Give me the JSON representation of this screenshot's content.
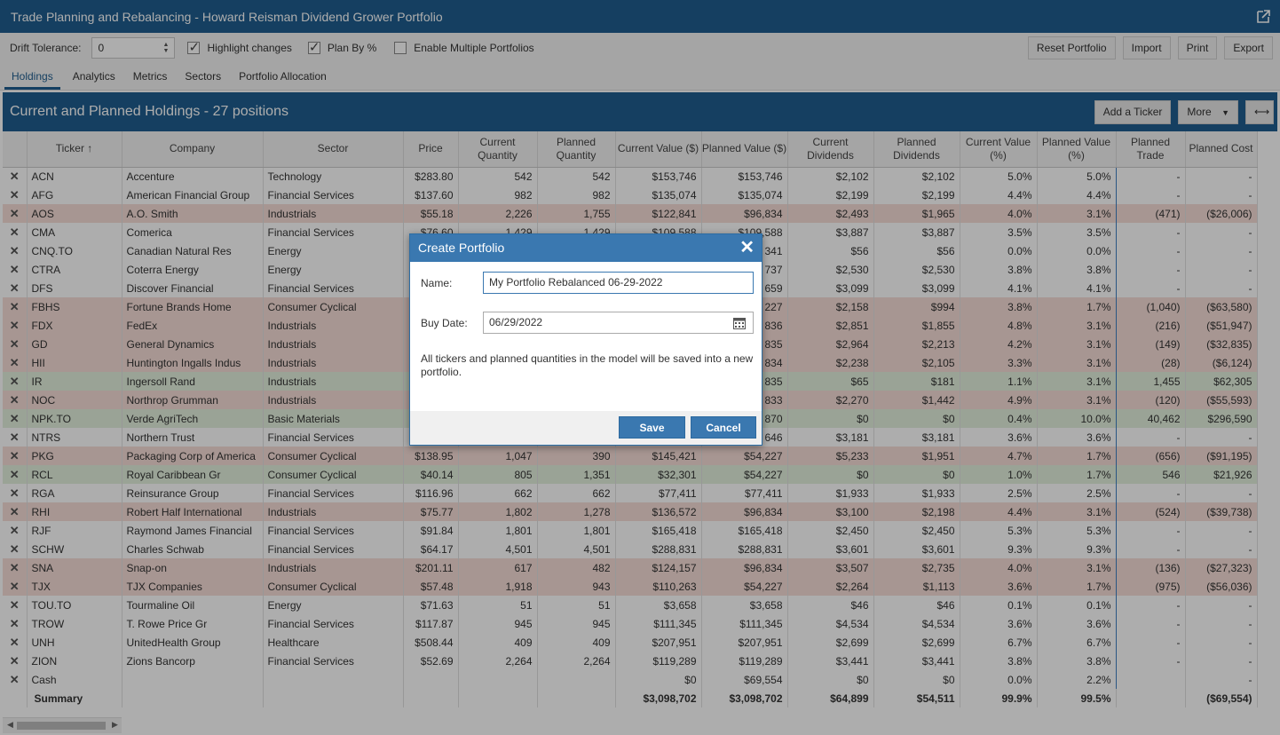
{
  "window": {
    "title": "Trade Planning and Rebalancing - Howard Reisman Dividend Grower Portfolio",
    "external_icon": "external-link-icon"
  },
  "toolbar": {
    "drift_label": "Drift Tolerance:",
    "drift_value": "0",
    "highlight_label": "Highlight changes",
    "highlight_checked": true,
    "planbypct_label": "Plan By %",
    "planbypct_checked": true,
    "multiple_label": "Enable Multiple Portfolios",
    "multiple_checked": false,
    "buttons": [
      "Reset Portfolio",
      "Import",
      "Print",
      "Export"
    ]
  },
  "tabs": [
    "Holdings",
    "Analytics",
    "Metrics",
    "Sectors",
    "Portfolio Allocation"
  ],
  "holdings": {
    "title": "Current and Planned Holdings - 27 positions",
    "add_ticker": "Add a Ticker",
    "more": "More",
    "expand_icon": "expand-horizontal-icon"
  },
  "columns": [
    "",
    "Ticker ↑",
    "Company",
    "Sector",
    "Price",
    "Current Quantity",
    "Planned Quantity",
    "Current Value ($)",
    "Planned Value ($)",
    "Current Dividends",
    "Planned Dividends",
    "Current Value (%)",
    "Planned Value (%)",
    "Planned Trade",
    "Planned Cost"
  ],
  "rows": [
    {
      "c": "white",
      "v": [
        "ACN",
        "Accenture",
        "Technology",
        "$283.80",
        "542",
        "542",
        "$153,746",
        "$153,746",
        "$2,102",
        "$2,102",
        "5.0%",
        "5.0%",
        "-",
        "-"
      ]
    },
    {
      "c": "white",
      "v": [
        "AFG",
        "American Financial Group",
        "Financial Services",
        "$137.60",
        "982",
        "982",
        "$135,074",
        "$135,074",
        "$2,199",
        "$2,199",
        "4.4%",
        "4.4%",
        "-",
        "-"
      ]
    },
    {
      "c": "red",
      "v": [
        "AOS",
        "A.O. Smith",
        "Industrials",
        "$55.18",
        "2,226",
        "1,755",
        "$122,841",
        "$96,834",
        "$2,493",
        "$1,965",
        "4.0%",
        "3.1%",
        "(471)",
        "($26,006)"
      ]
    },
    {
      "c": "white",
      "v": [
        "CMA",
        "Comerica",
        "Financial Services",
        "$76.60",
        "1,429",
        "1,429",
        "$109,588",
        "$109,588",
        "$3,887",
        "$3,887",
        "3.5%",
        "3.5%",
        "-",
        "-"
      ]
    },
    {
      "c": "white",
      "v": [
        "CNQ.TO",
        "Canadian Natural Res",
        "Energy",
        "",
        "",
        "",
        "",
        "341",
        "$56",
        "$56",
        "0.0%",
        "0.0%",
        "-",
        "-"
      ]
    },
    {
      "c": "white",
      "v": [
        "CTRA",
        "Coterra Energy",
        "Energy",
        "",
        "",
        "",
        "",
        "737",
        "$2,530",
        "$2,530",
        "3.8%",
        "3.8%",
        "-",
        "-"
      ]
    },
    {
      "c": "white",
      "v": [
        "DFS",
        "Discover Financial",
        "Financial Services",
        "",
        "",
        "",
        "",
        "659",
        "$3,099",
        "$3,099",
        "4.1%",
        "4.1%",
        "-",
        "-"
      ]
    },
    {
      "c": "red",
      "v": [
        "FBHS",
        "Fortune Brands Home",
        "Consumer Cyclical",
        "",
        "",
        "",
        "",
        "227",
        "$2,158",
        "$994",
        "3.8%",
        "1.7%",
        "(1,040)",
        "($63,580)"
      ]
    },
    {
      "c": "red",
      "v": [
        "FDX",
        "FedEx",
        "Industrials",
        "",
        "",
        "",
        "",
        "836",
        "$2,851",
        "$1,855",
        "4.8%",
        "3.1%",
        "(216)",
        "($51,947)"
      ]
    },
    {
      "c": "red",
      "v": [
        "GD",
        "General Dynamics",
        "Industrials",
        "",
        "",
        "",
        "",
        "835",
        "$2,964",
        "$2,213",
        "4.2%",
        "3.1%",
        "(149)",
        "($32,835)"
      ]
    },
    {
      "c": "red",
      "v": [
        "HII",
        "Huntington Ingalls Indus",
        "Industrials",
        "",
        "",
        "",
        "",
        "834",
        "$2,238",
        "$2,105",
        "3.3%",
        "3.1%",
        "(28)",
        "($6,124)"
      ]
    },
    {
      "c": "green",
      "v": [
        "IR",
        "Ingersoll Rand",
        "Industrials",
        "",
        "",
        "",
        "",
        "835",
        "$65",
        "$181",
        "1.1%",
        "3.1%",
        "1,455",
        "$62,305"
      ]
    },
    {
      "c": "red",
      "v": [
        "NOC",
        "Northrop Grumman",
        "Industrials",
        "",
        "",
        "",
        "",
        "833",
        "$2,270",
        "$1,442",
        "4.9%",
        "3.1%",
        "(120)",
        "($55,593)"
      ]
    },
    {
      "c": "green",
      "v": [
        "NPK.TO",
        "Verde AgriTech",
        "Basic Materials",
        "",
        "",
        "",
        "",
        "870",
        "$0",
        "$0",
        "0.4%",
        "10.0%",
        "40,462",
        "$296,590"
      ]
    },
    {
      "c": "white",
      "v": [
        "NTRS",
        "Northern Trust",
        "Financial Services",
        "",
        "",
        "",
        "",
        "646",
        "$3,181",
        "$3,181",
        "3.6%",
        "3.6%",
        "-",
        "-"
      ]
    },
    {
      "c": "red",
      "v": [
        "PKG",
        "Packaging Corp of America",
        "Consumer Cyclical",
        "$138.95",
        "1,047",
        "390",
        "$145,421",
        "$54,227",
        "$5,233",
        "$1,951",
        "4.7%",
        "1.7%",
        "(656)",
        "($91,195)"
      ]
    },
    {
      "c": "green",
      "v": [
        "RCL",
        "Royal Caribbean Gr",
        "Consumer Cyclical",
        "$40.14",
        "805",
        "1,351",
        "$32,301",
        "$54,227",
        "$0",
        "$0",
        "1.0%",
        "1.7%",
        "546",
        "$21,926"
      ]
    },
    {
      "c": "white",
      "v": [
        "RGA",
        "Reinsurance Group",
        "Financial Services",
        "$116.96",
        "662",
        "662",
        "$77,411",
        "$77,411",
        "$1,933",
        "$1,933",
        "2.5%",
        "2.5%",
        "-",
        "-"
      ]
    },
    {
      "c": "red",
      "v": [
        "RHI",
        "Robert Half International",
        "Industrials",
        "$75.77",
        "1,802",
        "1,278",
        "$136,572",
        "$96,834",
        "$3,100",
        "$2,198",
        "4.4%",
        "3.1%",
        "(524)",
        "($39,738)"
      ]
    },
    {
      "c": "white",
      "v": [
        "RJF",
        "Raymond James Financial",
        "Financial Services",
        "$91.84",
        "1,801",
        "1,801",
        "$165,418",
        "$165,418",
        "$2,450",
        "$2,450",
        "5.3%",
        "5.3%",
        "-",
        "-"
      ]
    },
    {
      "c": "white",
      "v": [
        "SCHW",
        "Charles Schwab",
        "Financial Services",
        "$64.17",
        "4,501",
        "4,501",
        "$288,831",
        "$288,831",
        "$3,601",
        "$3,601",
        "9.3%",
        "9.3%",
        "-",
        "-"
      ]
    },
    {
      "c": "red",
      "v": [
        "SNA",
        "Snap-on",
        "Industrials",
        "$201.11",
        "617",
        "482",
        "$124,157",
        "$96,834",
        "$3,507",
        "$2,735",
        "4.0%",
        "3.1%",
        "(136)",
        "($27,323)"
      ]
    },
    {
      "c": "red",
      "v": [
        "TJX",
        "TJX Companies",
        "Consumer Cyclical",
        "$57.48",
        "1,918",
        "943",
        "$110,263",
        "$54,227",
        "$2,264",
        "$1,113",
        "3.6%",
        "1.7%",
        "(975)",
        "($56,036)"
      ]
    },
    {
      "c": "white",
      "v": [
        "TOU.TO",
        "Tourmaline Oil",
        "Energy",
        "$71.63",
        "51",
        "51",
        "$3,658",
        "$3,658",
        "$46",
        "$46",
        "0.1%",
        "0.1%",
        "-",
        "-"
      ]
    },
    {
      "c": "white",
      "v": [
        "TROW",
        "T. Rowe Price Gr",
        "Financial Services",
        "$117.87",
        "945",
        "945",
        "$111,345",
        "$111,345",
        "$4,534",
        "$4,534",
        "3.6%",
        "3.6%",
        "-",
        "-"
      ]
    },
    {
      "c": "white",
      "v": [
        "UNH",
        "UnitedHealth Group",
        "Healthcare",
        "$508.44",
        "409",
        "409",
        "$207,951",
        "$207,951",
        "$2,699",
        "$2,699",
        "6.7%",
        "6.7%",
        "-",
        "-"
      ]
    },
    {
      "c": "white",
      "v": [
        "ZION",
        "Zions Bancorp",
        "Financial Services",
        "$52.69",
        "2,264",
        "2,264",
        "$119,289",
        "$119,289",
        "$3,441",
        "$3,441",
        "3.8%",
        "3.8%",
        "-",
        "-"
      ]
    },
    {
      "c": "cash",
      "v": [
        "Cash",
        "",
        "",
        "",
        "",
        "",
        "$0",
        "$69,554",
        "$0",
        "$0",
        "0.0%",
        "2.2%",
        "",
        "-"
      ]
    }
  ],
  "summary": [
    "Summary",
    "",
    "",
    "",
    "",
    "",
    "$3,098,702",
    "$3,098,702",
    "$64,899",
    "$54,511",
    "99.9%",
    "99.5%",
    "",
    "($69,554)"
  ],
  "modal": {
    "title": "Create Portfolio",
    "name_label": "Name:",
    "name_value": "My Portfolio Rebalanced 06-29-2022",
    "date_label": "Buy Date:",
    "date_value": "06/29/2022",
    "message": "All tickers and planned quantities in the model will be saved into a new portfolio.",
    "save": "Save",
    "cancel": "Cancel"
  },
  "colors": {
    "brand": "#1f5e8f",
    "red_row": "#f6ded7",
    "green_row": "#e3f1de",
    "button": "#3a78b0"
  }
}
